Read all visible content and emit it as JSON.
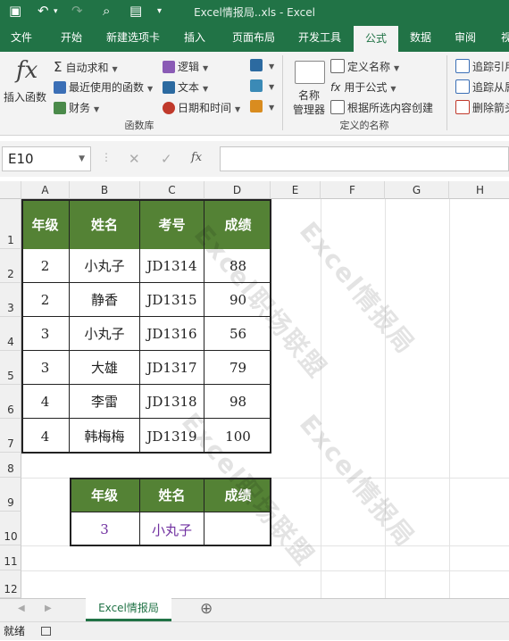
{
  "window": {
    "title": "Excel情报局..xls  -  Excel"
  },
  "tabs": [
    "文件",
    "开始",
    "新建选项卡",
    "插入",
    "页面布局",
    "开发工具",
    "公式",
    "数据",
    "审阅",
    "视"
  ],
  "active_tab": "公式",
  "ribbon": {
    "insert_function": "插入函数",
    "fx_symbol": "fx",
    "autosum": "自动求和",
    "recent": "最近使用的函数",
    "finance": "财务",
    "logic": "逻辑",
    "text": "文本",
    "datetime": "日期和时间",
    "function_library": "函数库",
    "name_manager_1": "名称",
    "name_manager_2": "管理器",
    "define_name": "定义名称",
    "use_in_formula": "用于公式",
    "create_from_selection": "根据所选内容创建",
    "defined_names": "定义的名称",
    "trace_precedents": "追踪引用",
    "trace_dependents": "追踪从属",
    "remove_arrows": "删除箭头"
  },
  "formula_bar": {
    "name_box": "E10",
    "cancel": "✕",
    "enter": "✓",
    "fx": "fx",
    "formula": ""
  },
  "columns": [
    "A",
    "B",
    "C",
    "D",
    "E",
    "F",
    "G",
    "H"
  ],
  "rows": [
    "1",
    "2",
    "3",
    "4",
    "5",
    "6",
    "7",
    "8",
    "9",
    "10",
    "11",
    "12"
  ],
  "table1": {
    "headers": [
      "年级",
      "姓名",
      "考号",
      "成绩"
    ],
    "rows": [
      [
        "2",
        "小丸子",
        "JD1314",
        "88"
      ],
      [
        "2",
        "静香",
        "JD1315",
        "90"
      ],
      [
        "3",
        "小丸子",
        "JD1316",
        "56"
      ],
      [
        "3",
        "大雄",
        "JD1317",
        "79"
      ],
      [
        "4",
        "李雷",
        "JD1318",
        "98"
      ],
      [
        "4",
        "韩梅梅",
        "JD1319",
        "100"
      ]
    ]
  },
  "table2": {
    "headers": [
      "年级",
      "姓名",
      "成绩"
    ],
    "row": [
      "3",
      "小丸子",
      ""
    ]
  },
  "watermarks": [
    "Excel情报局",
    "Excel职场联盟",
    "Excel情报局",
    "Excel职场联盟"
  ],
  "sheet_tab": "Excel情报局",
  "add_sheet": "⊕",
  "status": "就绪",
  "colors": {
    "excel_green": "#217346",
    "header_green": "#548235",
    "purple_text": "#7030a0"
  }
}
